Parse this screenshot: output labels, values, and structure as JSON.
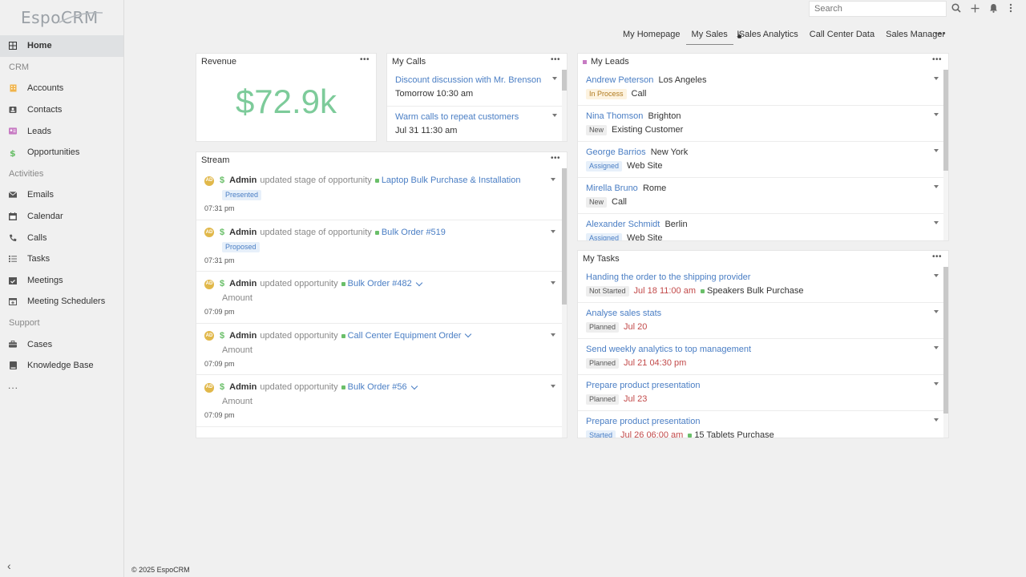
{
  "app": {
    "logo_text": "EspoCRM",
    "copyright": "© 2025 EspoCRM"
  },
  "search": {
    "placeholder": "Search"
  },
  "sidebar": {
    "items": [
      {
        "label": "Home",
        "icon": "home-grid-icon",
        "active": true
      },
      {
        "group": "CRM"
      },
      {
        "label": "Accounts",
        "icon": "building-icon",
        "color": "#f0b34a"
      },
      {
        "label": "Contacts",
        "icon": "id-card-icon",
        "color": "#555"
      },
      {
        "label": "Leads",
        "icon": "address-card-icon",
        "color": "#c77bc3"
      },
      {
        "label": "Opportunities",
        "icon": "dollar-icon",
        "color": "#6abf69"
      },
      {
        "group": "Activities"
      },
      {
        "label": "Emails",
        "icon": "envelope-icon",
        "color": "#555"
      },
      {
        "label": "Calendar",
        "icon": "calendar-icon",
        "color": "#555"
      },
      {
        "label": "Calls",
        "icon": "phone-icon",
        "color": "#555"
      },
      {
        "label": "Tasks",
        "icon": "tasks-icon",
        "color": "#555"
      },
      {
        "label": "Meetings",
        "icon": "calendar-check-icon",
        "color": "#555"
      },
      {
        "label": "Meeting Schedulers",
        "icon": "calendar-plus-icon",
        "color": "#555"
      },
      {
        "group": "Support"
      },
      {
        "label": "Cases",
        "icon": "briefcase-icon",
        "color": "#555"
      },
      {
        "label": "Knowledge Base",
        "icon": "book-icon",
        "color": "#555"
      }
    ],
    "more": "..."
  },
  "tabs": [
    {
      "label": "My Homepage",
      "active": false
    },
    {
      "label": "My Sales",
      "active": true
    },
    {
      "label": "Sales Analytics",
      "active": false
    },
    {
      "label": "Call Center Data",
      "active": false
    },
    {
      "label": "Sales Manager",
      "active": false
    }
  ],
  "tabs_more": "•••",
  "dashlet_menu": "•••",
  "revenue": {
    "title": "Revenue",
    "value": "$72.9k",
    "color": "#7dcb9a"
  },
  "my_calls": {
    "title": "My Calls",
    "items": [
      {
        "name": "Discount discussion with Mr. Brenson",
        "when": "Tomorrow 10:30 am"
      },
      {
        "name": "Warm calls to repeat customers",
        "when": "Jul 31 11:30 am"
      }
    ]
  },
  "my_leads": {
    "title": "My Leads",
    "items": [
      {
        "name": "Andrew Peterson",
        "city": "Los Angeles",
        "status": "In Process",
        "status_style": "warn",
        "source": "Call"
      },
      {
        "name": "Nina Thomson",
        "city": "Brighton",
        "status": "New",
        "status_style": "plain",
        "source": "Existing Customer"
      },
      {
        "name": "George Barrios",
        "city": "New York",
        "status": "Assigned",
        "status_style": "info",
        "source": "Web Site"
      },
      {
        "name": "Mirella Bruno",
        "city": "Rome",
        "status": "New",
        "status_style": "plain",
        "source": "Call"
      },
      {
        "name": "Alexander Schmidt",
        "city": "Berlin",
        "status": "Assigned",
        "status_style": "info",
        "source": "Web Site"
      }
    ]
  },
  "my_tasks": {
    "title": "My Tasks",
    "items": [
      {
        "name": "Handing the order to the shipping provider",
        "status": "Not Started",
        "date": "Jul 18 11:00 am",
        "parent": "Speakers Bulk Purchase"
      },
      {
        "name": "Analyse sales stats",
        "status": "Planned",
        "date": "Jul 20",
        "parent": ""
      },
      {
        "name": "Send weekly analytics to top management",
        "status": "Planned",
        "date": "Jul 21 04:30 pm",
        "parent": ""
      },
      {
        "name": "Prepare product presentation",
        "status": "Planned",
        "date": "Jul 23",
        "parent": ""
      },
      {
        "name": "Prepare product presentation",
        "status": "Started",
        "date": "Jul 26 06:00 am",
        "parent": "15 Tablets Purchase"
      }
    ]
  },
  "stream": {
    "title": "Stream",
    "items": [
      {
        "avatar": "AD",
        "user": "Admin",
        "action": "updated stage of opportunity",
        "target": "Laptop Bulk Purchase & Installation",
        "badge": "Presented",
        "field": "",
        "time": "07:31 pm",
        "expand": false
      },
      {
        "avatar": "AD",
        "user": "Admin",
        "action": "updated stage of opportunity",
        "target": "Bulk Order #519",
        "badge": "Proposed",
        "field": "",
        "time": "07:31 pm",
        "expand": false
      },
      {
        "avatar": "AD",
        "user": "Admin",
        "action": "updated opportunity",
        "target": "Bulk Order #482",
        "badge": "",
        "field": "Amount",
        "time": "07:09 pm",
        "expand": true
      },
      {
        "avatar": "AD",
        "user": "Admin",
        "action": "updated opportunity",
        "target": "Call Center Equipment Order",
        "badge": "",
        "field": "Amount",
        "time": "07:09 pm",
        "expand": true
      },
      {
        "avatar": "AD",
        "user": "Admin",
        "action": "updated opportunity",
        "target": "Bulk Order #56",
        "badge": "",
        "field": "Amount",
        "time": "07:09 pm",
        "expand": true
      }
    ]
  }
}
